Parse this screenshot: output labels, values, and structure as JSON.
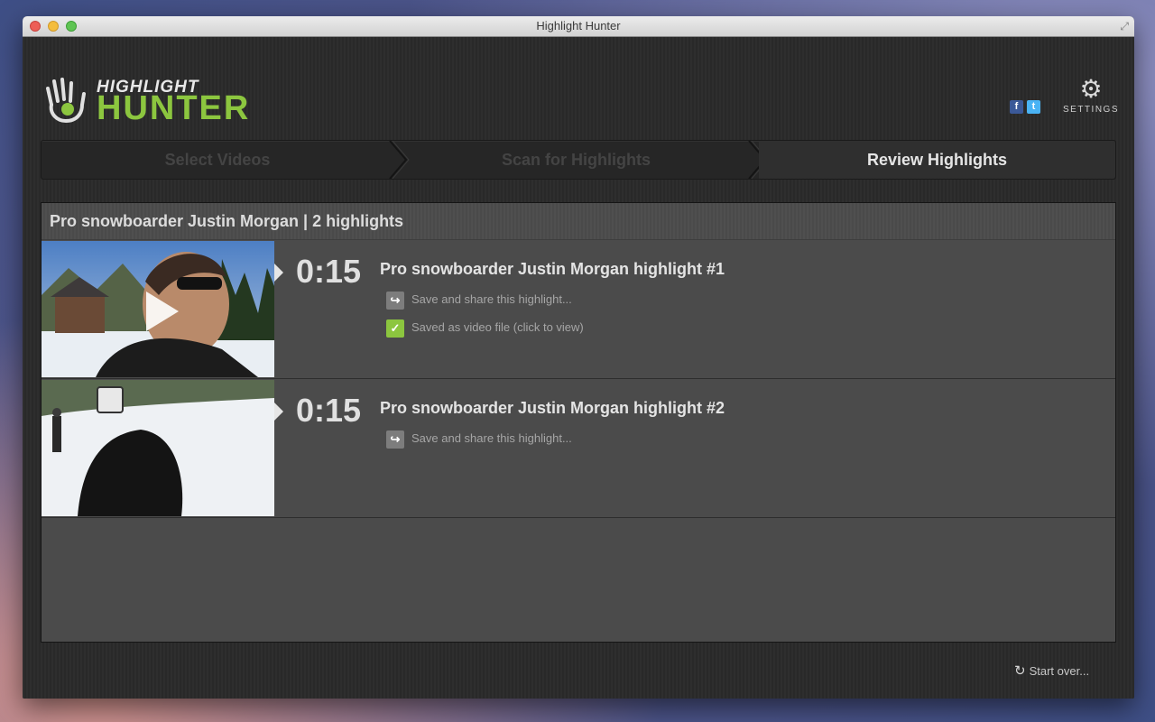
{
  "window": {
    "title": "Highlight Hunter"
  },
  "logo": {
    "line1": "HIGHLIGHT",
    "line2": "HUNTER"
  },
  "header": {
    "social": [
      {
        "name": "facebook-icon",
        "glyph": "f"
      },
      {
        "name": "twitter-icon",
        "glyph": "t"
      }
    ],
    "settings_label": "SETTINGS"
  },
  "steps": [
    {
      "label": "Select Videos",
      "active": false
    },
    {
      "label": "Scan for Highlights",
      "active": false
    },
    {
      "label": "Review Highlights",
      "active": true
    }
  ],
  "panel": {
    "header": "Pro snowboarder Justin Morgan | 2 highlights",
    "highlights": [
      {
        "time": "0:15",
        "title": "Pro snowboarder Justin Morgan highlight #1",
        "share_label": "Save and share this highlight...",
        "saved_label": "Saved as video file (click to view)"
      },
      {
        "time": "0:15",
        "title": "Pro snowboarder Justin Morgan highlight #2",
        "share_label": "Save and share this highlight..."
      }
    ]
  },
  "footer": {
    "start_over_label": "Start over..."
  },
  "colors": {
    "accent": "#8cc63f",
    "panel_bg": "#4b4b4b",
    "window_bg": "#2b2b2b"
  }
}
